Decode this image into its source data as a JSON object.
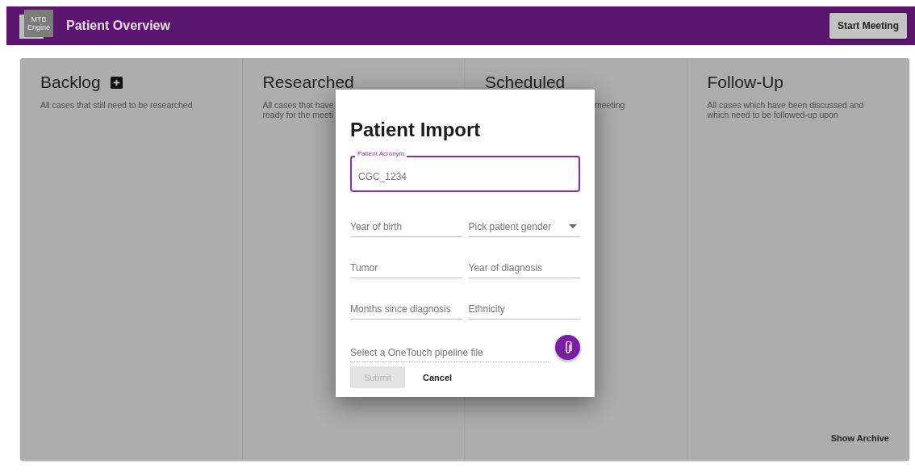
{
  "header": {
    "logo_lines": [
      "MTB",
      "Engine"
    ],
    "title": "Patient Overview",
    "action": "Start Meeting"
  },
  "columns": [
    {
      "title": "Backlog",
      "add_button": true,
      "description_lines": [
        "All cases that still need to be researched"
      ]
    },
    {
      "title": "Researched",
      "add_button": false,
      "description_lines": [
        "All cases that have",
        "ready for the meeti"
      ]
    },
    {
      "title": "Scheduled",
      "add_button": false,
      "description_lines": [
        "meeting"
      ],
      "hidden_start": true
    },
    {
      "title": "Follow-Up",
      "add_button": false,
      "description_lines": [
        "All cases which have been discussed and",
        "which need to be followed-up upon"
      ],
      "footer_link": "Show Archive"
    }
  ],
  "dialog": {
    "title": "Patient Import",
    "acronym": {
      "label": "Patient Acronym",
      "placeholder": "CGC_1234",
      "focused": true
    },
    "fields": [
      {
        "kind": "input",
        "placeholder": "Year of birth"
      },
      {
        "kind": "select",
        "placeholder": "Pick patient gender"
      },
      {
        "kind": "input",
        "placeholder": "Tumor"
      },
      {
        "kind": "input",
        "placeholder": "Year of diagnosis"
      },
      {
        "kind": "input",
        "placeholder": "Months since diagnosis"
      },
      {
        "kind": "input",
        "placeholder": "Ethnicity"
      }
    ],
    "file": {
      "placeholder": "Select a OneTouch pipeline file"
    },
    "buttons": [
      {
        "label": "Submit",
        "disabled": true
      },
      {
        "label": "Cancel",
        "disabled": false
      }
    ]
  }
}
